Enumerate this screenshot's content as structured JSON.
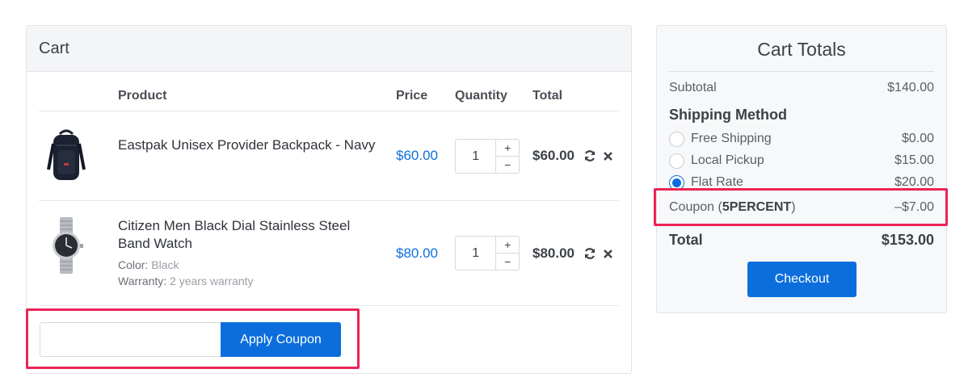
{
  "cart": {
    "title": "Cart",
    "headers": {
      "product": "Product",
      "price": "Price",
      "quantity": "Quantity",
      "total": "Total"
    },
    "items": [
      {
        "name": "Eastpak Unisex Provider Backpack - Navy",
        "price": "$60.00",
        "quantity": "1",
        "total": "$60.00",
        "image_icon": "backpack-image"
      },
      {
        "name": "Citizen Men Black Dial Stainless Steel Band Watch",
        "price": "$80.00",
        "quantity": "1",
        "total": "$80.00",
        "image_icon": "watch-image",
        "options": [
          {
            "label": "Color:",
            "value": "Black"
          },
          {
            "label": "Warranty:",
            "value": "2 years warranty"
          }
        ]
      }
    ],
    "qty_plus": "+",
    "qty_minus": "−",
    "coupon": {
      "input_value": "",
      "placeholder": "",
      "apply_label": "Apply Coupon"
    }
  },
  "totals": {
    "title": "Cart Totals",
    "subtotal_label": "Subtotal",
    "subtotal_value": "$140.00",
    "shipping_heading": "Shipping Method",
    "shipping_options": [
      {
        "name": "Free Shipping",
        "price": "$0.00",
        "selected": false
      },
      {
        "name": "Local Pickup",
        "price": "$15.00",
        "selected": false
      },
      {
        "name": "Flat Rate",
        "price": "$20.00",
        "selected": true
      }
    ],
    "coupon_label": "Coupon (",
    "coupon_code": "5PERCENT",
    "coupon_label_end": ")",
    "coupon_value": "–$7.00",
    "total_label": "Total",
    "total_value": "$153.00",
    "checkout_label": "Checkout"
  },
  "colors": {
    "accent": "#0c6edc",
    "highlight": "#ec2457",
    "price_text": "#0f6fdc"
  }
}
